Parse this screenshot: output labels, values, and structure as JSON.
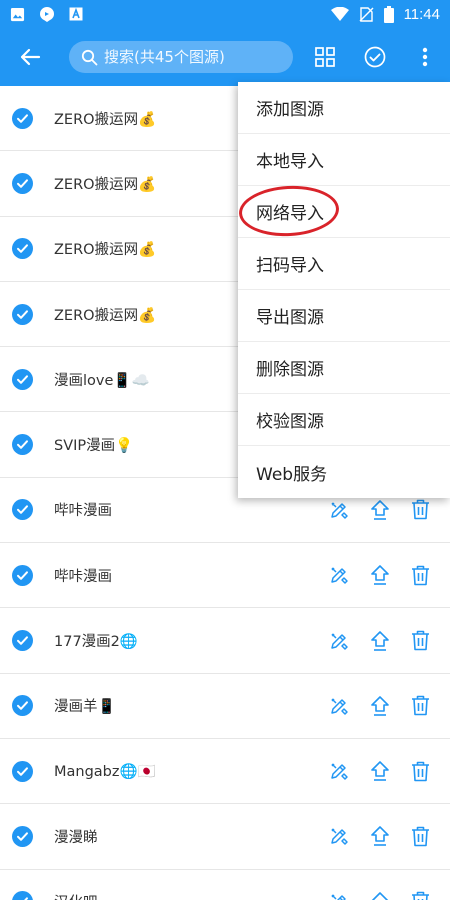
{
  "status_bar": {
    "time": "11:44",
    "icons": [
      "image-icon",
      "bubble-icon",
      "font-a-icon",
      "wifi-icon",
      "no-sim-icon",
      "battery-icon"
    ]
  },
  "app_bar": {
    "back_icon": "arrow-left-icon",
    "search_placeholder": "搜索(共45个图源)",
    "actions": [
      "grid-icon",
      "check-circle-icon",
      "more-vert-icon"
    ]
  },
  "sources": [
    {
      "name": "ZERO搬运网💰",
      "checked": true
    },
    {
      "name": "ZERO搬运网💰",
      "checked": true
    },
    {
      "name": "ZERO搬运网💰",
      "checked": true
    },
    {
      "name": "ZERO搬运网💰",
      "checked": true
    },
    {
      "name": "漫画love📱☁️",
      "checked": true
    },
    {
      "name": "SVIP漫画💡",
      "checked": true
    },
    {
      "name": "哔咔漫画",
      "checked": true
    },
    {
      "name": "哔咔漫画",
      "checked": true
    },
    {
      "name": "177漫画2🌐",
      "checked": true
    },
    {
      "name": "漫画羊📱",
      "checked": true
    },
    {
      "name": "Mangabz🌐🇯🇵",
      "checked": true
    },
    {
      "name": "漫漫睇",
      "checked": true
    },
    {
      "name": "汉化吧",
      "checked": true
    }
  ],
  "row_action_icons": [
    "edit-icon",
    "upload-icon",
    "delete-icon"
  ],
  "menu": {
    "items": [
      "添加图源",
      "本地导入",
      "网络导入",
      "扫码导入",
      "导出图源",
      "删除图源",
      "校验图源",
      "Web服务"
    ],
    "highlighted_index": 2
  },
  "colors": {
    "primary": "#2196f3",
    "icon_blue": "#2196f3",
    "highlight_ring": "#d9232a"
  }
}
